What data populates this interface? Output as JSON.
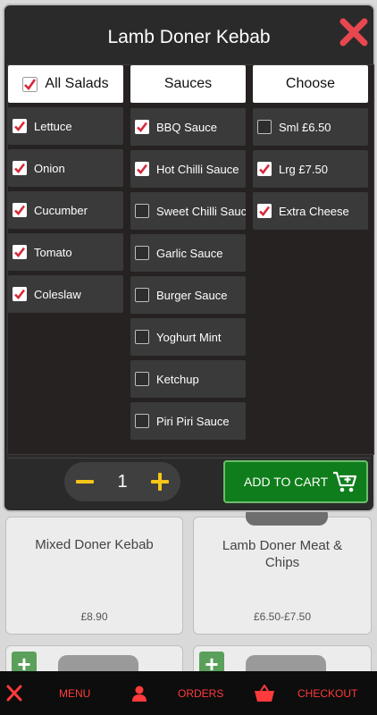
{
  "modal": {
    "title": "Lamb Doner Kebab",
    "columns": {
      "salads": {
        "header": "All Salads",
        "header_checked": true,
        "items": [
          {
            "label": "Lettuce",
            "checked": true
          },
          {
            "label": "Onion",
            "checked": true
          },
          {
            "label": "Cucumber",
            "checked": true
          },
          {
            "label": "Tomato",
            "checked": true
          },
          {
            "label": "Coleslaw",
            "checked": true
          }
        ]
      },
      "sauces": {
        "header": "Sauces",
        "items": [
          {
            "label": "BBQ Sauce",
            "checked": true
          },
          {
            "label": "Hot Chilli Sauce",
            "checked": true
          },
          {
            "label": "Sweet Chilli Sauce",
            "checked": false
          },
          {
            "label": "Garlic Sauce",
            "checked": false
          },
          {
            "label": "Burger Sauce",
            "checked": false
          },
          {
            "label": "Yoghurt Mint",
            "checked": false
          },
          {
            "label": "Ketchup",
            "checked": false
          },
          {
            "label": "Piri Piri Sauce",
            "checked": false
          }
        ]
      },
      "choose": {
        "header": "Choose",
        "items": [
          {
            "label": "Sml £6.50",
            "checked": false
          },
          {
            "label": "Lrg £7.50",
            "checked": true
          },
          {
            "label": "Extra Cheese",
            "checked": true
          }
        ]
      }
    },
    "quantity": "1",
    "add_to_cart_label": "ADD TO CART"
  },
  "background_products": [
    {
      "name": "Mixed Doner Kebab",
      "price": "£8.90"
    },
    {
      "name": "Lamb Doner Meat & Chips",
      "price": "£6.50-£7.50"
    }
  ],
  "nav": {
    "menu": "MENU",
    "orders": "ORDERS",
    "checkout": "CHECKOUT"
  },
  "colors": {
    "accent_red": "#ff3b3b",
    "checkbox_red": "#d42a3a",
    "qty_yellow": "#f5c518",
    "cart_green": "#0f7d1b"
  }
}
